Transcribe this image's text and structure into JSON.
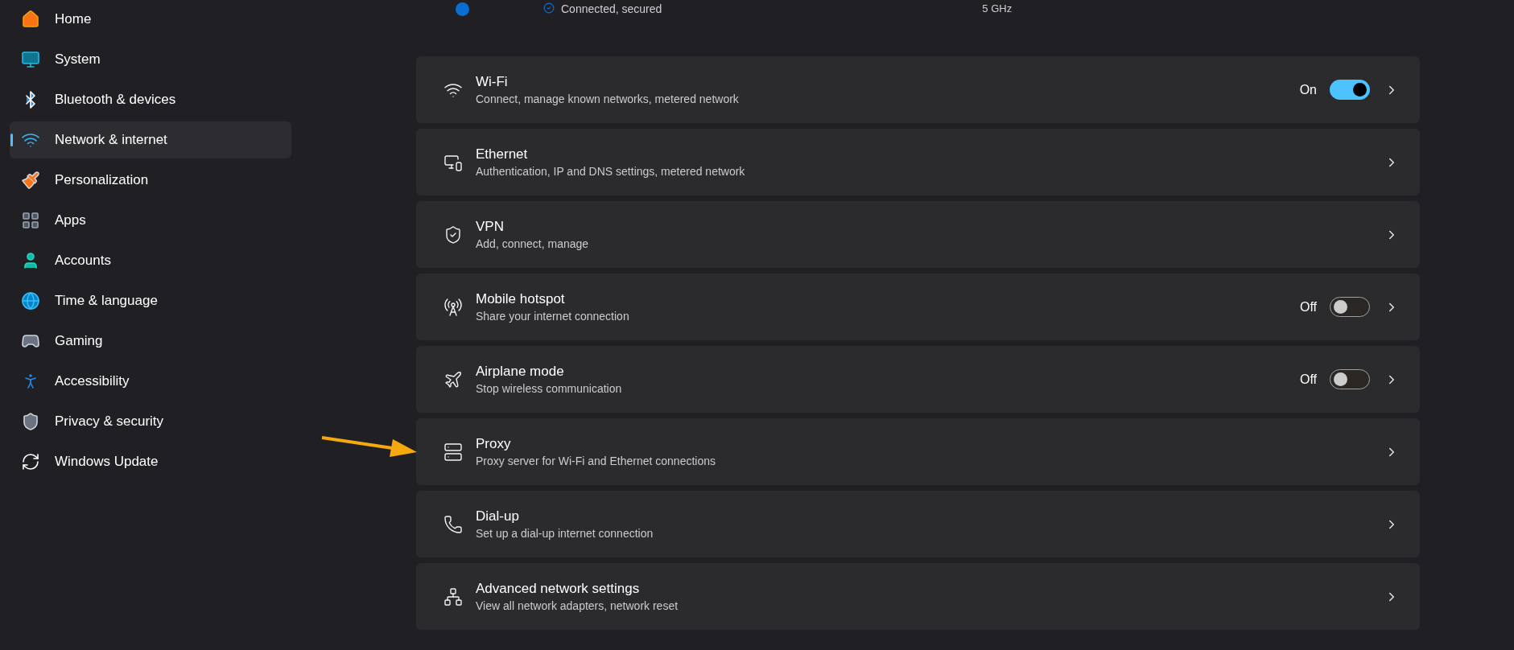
{
  "sidebar": {
    "items": [
      {
        "label": "Home",
        "selected": false
      },
      {
        "label": "System",
        "selected": false
      },
      {
        "label": "Bluetooth & devices",
        "selected": false
      },
      {
        "label": "Network & internet",
        "selected": true
      },
      {
        "label": "Personalization",
        "selected": false
      },
      {
        "label": "Apps",
        "selected": false
      },
      {
        "label": "Accounts",
        "selected": false
      },
      {
        "label": "Time & language",
        "selected": false
      },
      {
        "label": "Gaming",
        "selected": false
      },
      {
        "label": "Accessibility",
        "selected": false
      },
      {
        "label": "Privacy & security",
        "selected": false
      },
      {
        "label": "Windows Update",
        "selected": false
      }
    ]
  },
  "connection": {
    "status": "Connected, secured",
    "band": "5 GHz"
  },
  "settings": [
    {
      "title": "Wi-Fi",
      "description": "Connect, manage known networks, metered network",
      "toggle": {
        "label": "On",
        "on": true
      }
    },
    {
      "title": "Ethernet",
      "description": "Authentication, IP and DNS settings, metered network"
    },
    {
      "title": "VPN",
      "description": "Add, connect, manage"
    },
    {
      "title": "Mobile hotspot",
      "description": "Share your internet connection",
      "toggle": {
        "label": "Off",
        "on": false
      }
    },
    {
      "title": "Airplane mode",
      "description": "Stop wireless communication",
      "toggle": {
        "label": "Off",
        "on": false
      }
    },
    {
      "title": "Proxy",
      "description": "Proxy server for Wi-Fi and Ethernet connections"
    },
    {
      "title": "Dial-up",
      "description": "Set up a dial-up internet connection"
    },
    {
      "title": "Advanced network settings",
      "description": "View all network adapters, network reset"
    }
  ]
}
